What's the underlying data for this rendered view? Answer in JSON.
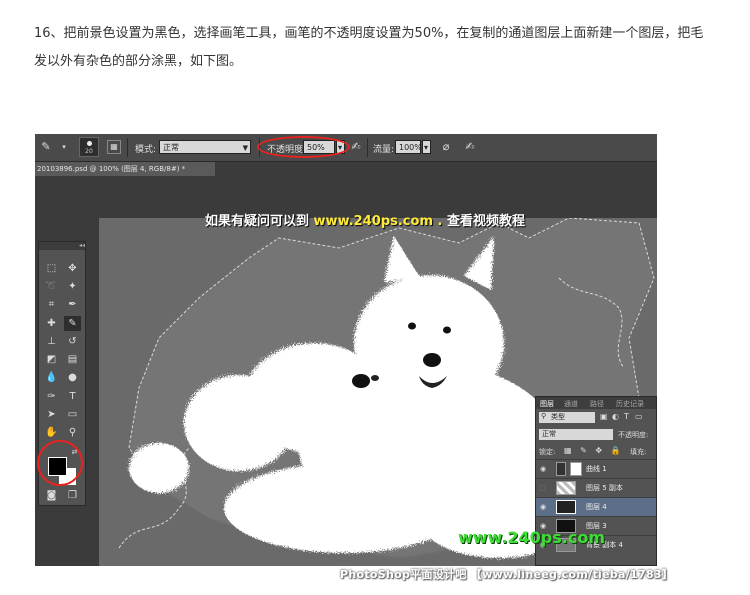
{
  "article": {
    "step_text": "16、把前景色设置为黑色，选择画笔工具，画笔的不透明度设置为50%，在复制的通道图层上面新建一个图层，把毛发以外有杂色的部分涂黑，如下图。"
  },
  "options_bar": {
    "brush_size": "20",
    "mode_label": "模式:",
    "mode_value": "正常",
    "opacity_label": "不透明度:",
    "opacity_value": "50%",
    "flow_label": "流量:",
    "flow_value": "100%"
  },
  "document_tab": "20103896.psd @ 100% (图层 4, RGB/8#) *",
  "canvas_watermark": {
    "prefix": "如果有疑问可以到",
    "url": "www.240ps.com",
    "suffix": "查看视频教程"
  },
  "canvas_footer_watermark": "www.240ps.com",
  "layers_panel": {
    "tabs": [
      "图层",
      "通道",
      "路径",
      "历史记录"
    ],
    "filter_label": "类型",
    "blend_mode": "正常",
    "opacity_label": "不透明度:",
    "lock_label": "锁定:",
    "fill_label": "填充:",
    "layers": [
      {
        "name": "曲线 1",
        "visible": true,
        "selected": false
      },
      {
        "name": "图层 5 副本",
        "visible": false,
        "selected": false
      },
      {
        "name": "图层 4",
        "visible": true,
        "selected": true
      },
      {
        "name": "图层 3",
        "visible": true,
        "selected": false
      },
      {
        "name": "背景 副本 4",
        "visible": true,
        "selected": false
      }
    ]
  },
  "colors": {
    "foreground": "#000000",
    "background": "#ffffff",
    "highlight_ring": "#e8231f"
  },
  "site_caption": "PhotoShop平面设计吧 【www.lineeg.com/tieba/1783】"
}
